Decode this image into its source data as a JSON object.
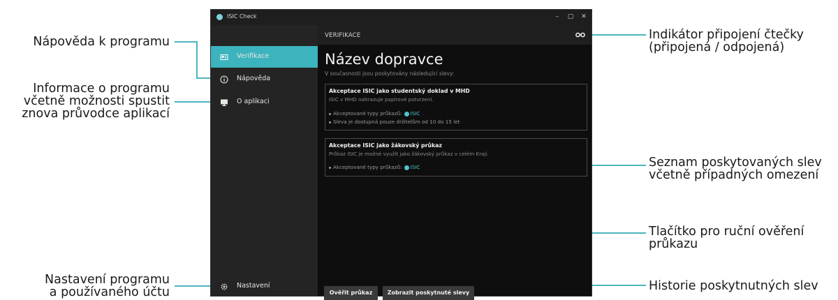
{
  "window": {
    "title": "ISIC Check",
    "minimize": "–",
    "maximize": "▢",
    "close": "✕"
  },
  "sidebar": {
    "items": [
      {
        "label": "Verifikace",
        "icon": "id-card-icon",
        "active": true
      },
      {
        "label": "Nápověda",
        "icon": "info-icon",
        "active": false
      },
      {
        "label": "O aplikaci",
        "icon": "monitor-icon",
        "active": false
      }
    ],
    "settings_label": "Nastavení"
  },
  "header": {
    "title": "VERIFIKACE",
    "reader_icon": "link-icon"
  },
  "content": {
    "carrier_title": "Název dopravce",
    "subtitle": "V současnosti jsou poskytovány následující slevy:",
    "cards": [
      {
        "title": "Akceptace ISIC jako studentský doklad v MHD",
        "description": "ISIC v MHD nahrazuje papírové potvrzení.",
        "accepted_label": "Akceptované typy průkazů:",
        "accepted_value": "ISIC",
        "note": "Sleva je dostupná pouze držitelům od 10 do 15 let"
      },
      {
        "title": "Akceptace ISIC jako žákovský průkaz",
        "description": "Průkaz ISIC je možné využít jako žákovský průkaz v celém Kraji.",
        "accepted_label": "Akceptované typy průkazů:",
        "accepted_value": "ISIC"
      }
    ],
    "verify_button": "Ověřit průkaz",
    "history_button": "Zobrazit poskytnuté slevy"
  },
  "annotations": {
    "help": [
      "Nápověda k programu"
    ],
    "about": [
      "Informace o programu",
      "včetně možnosti spustit",
      "znova průvodce aplikací"
    ],
    "settings": [
      "Nastavení programu",
      "a používaného účtu"
    ],
    "reader": [
      "Indikátor připojení čtečky",
      "(připojená / odpojená)"
    ],
    "discounts": [
      "Seznam poskytovaných slev",
      "včetně případných omezení"
    ],
    "manual": [
      "Tlačítko pro ruční ověření",
      "průkazu"
    ],
    "history": [
      "Historie poskytnutných slev"
    ]
  },
  "colors": {
    "accent": "#3cb3bd",
    "sidebar": "#242424",
    "window_bg": "#0e0e0e",
    "callout_line": "#49b6bd"
  }
}
